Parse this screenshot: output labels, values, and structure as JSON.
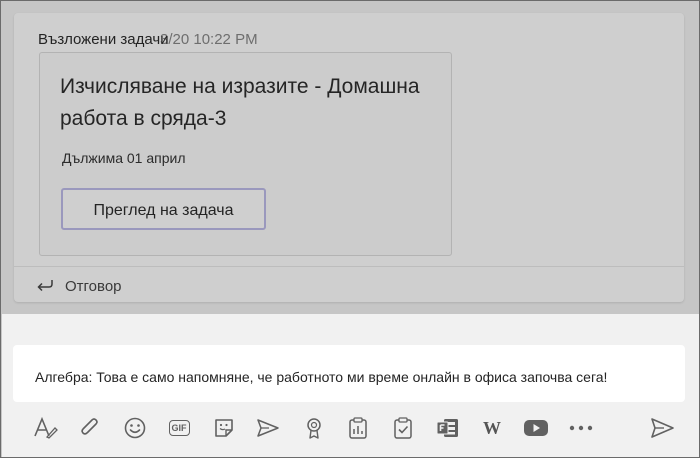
{
  "message": {
    "timestamp": "3/20 10:22 PM",
    "card_title": "Възложени задачи",
    "assignment_title": "Изчисляване на изразите - Домашна работа в сряда-3",
    "due_text": "Дължима 01 април",
    "view_button_label": "Преглед на задача",
    "reply_label": "Отговор"
  },
  "compose": {
    "text": "Алгебра: Това е само напомняне, че работното ми време онлайн в офиса започва сега!"
  },
  "toolbar": {
    "gif_label": "GIF",
    "wiki_label": "W",
    "icons": [
      "format-icon",
      "attach-icon",
      "emoji-icon",
      "gif-icon",
      "sticker-icon",
      "schedule-icon",
      "praise-icon",
      "forms-icon",
      "approvals-icon",
      "forms-app-icon",
      "wikipedia-icon",
      "youtube-icon",
      "more-icon",
      "send-icon"
    ]
  },
  "colors": {
    "overlay": "#c6c6c6",
    "compose_bg": "#f1f1f1",
    "button_border": "#9a98bd",
    "icon": "#616161"
  }
}
